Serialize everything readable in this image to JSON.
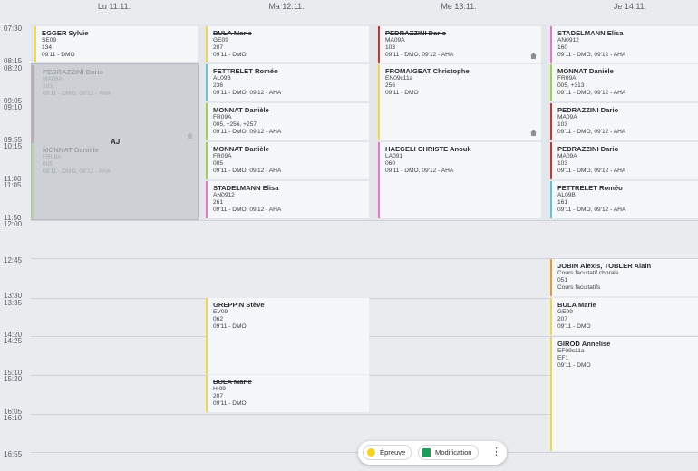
{
  "days": [
    {
      "label": "Lu 11.11."
    },
    {
      "label": "Ma 12.11."
    },
    {
      "label": "Me 13.11."
    },
    {
      "label": "Je 14.11."
    }
  ],
  "time_labels": [
    "07:30",
    "08:15",
    "08:20",
    "09:05",
    "09:10",
    "09:55",
    "10:15",
    "11:00",
    "11:05",
    "11:50",
    "12:00",
    "12:45",
    "13:30",
    "13:35",
    "14:20",
    "14:25",
    "15:10",
    "15:20",
    "16:05",
    "16:10",
    "16:55"
  ],
  "absence": {
    "code": "AJ",
    "lessons": [
      {
        "teacher": "PEDRAZZINI Dario",
        "lines": [
          "MA09A",
          "103",
          "09'11 - DMO, 09'12 - AHA"
        ]
      },
      {
        "teacher": "MONNAT Danièle",
        "lines": [
          "FR09A",
          "005",
          "09'11 - DMO, 09'12 - AHA"
        ]
      }
    ]
  },
  "lessons": [
    {
      "teacher": "EGGER Sylvie",
      "lines": [
        "SE09",
        "134",
        "09'11 - DMO"
      ],
      "color": "#f0d64a"
    },
    {
      "teacher": "BULA Marie",
      "lines": [
        "GE09",
        "207",
        "09'11 - DMO"
      ],
      "color": "#f0d64a",
      "cancelled": true
    },
    {
      "teacher": "FETTRELET Roméo",
      "lines": [
        "AL09B",
        "236",
        "09'11 - DMO, 09'12 - AHA"
      ],
      "color": "#59c9d8"
    },
    {
      "teacher": "MONNAT Danièle",
      "lines": [
        "FR09A",
        "005, +256, +257",
        "09'11 - DMO, 09'12 - AHA"
      ],
      "color": "#9ed24a"
    },
    {
      "teacher": "MONNAT Danièle",
      "lines": [
        "FR09A",
        "005",
        "09'11 - DMO, 09'12 - AHA"
      ],
      "color": "#9ed24a"
    },
    {
      "teacher": "STADELMANN Elisa",
      "lines": [
        "AN0912",
        "261",
        "09'11 - DMO, 09'12 - AHA"
      ],
      "color": "#e874c9"
    },
    {
      "teacher": "GREPPIN Stève",
      "lines": [
        "EV09",
        "062",
        "09'11 - DMO"
      ],
      "color": "#f0d64a"
    },
    {
      "teacher": "BULA Marie",
      "lines": [
        "HI09",
        "207",
        "09'11 - DMO"
      ],
      "color": "#f0d64a",
      "cancelled": true
    },
    {
      "teacher": "PEDRAZZINI Dario",
      "lines": [
        "MA09A",
        "103",
        "09'11 - DMO, 09'12 - AHA"
      ],
      "color": "#d2302f",
      "cancelled": true,
      "house": true
    },
    {
      "teacher": "FROMAIGEAT Christophe",
      "lines": [
        "EN09c11a",
        "256",
        "09'11 - DMO"
      ],
      "color": "#f0d64a",
      "house": true
    },
    {
      "teacher": "HAEGELI CHRISTE Anouk",
      "lines": [
        "LA091",
        "060",
        "09'11 - DMO, 09'12 - AHA"
      ],
      "color": "#e874c9"
    },
    {
      "teacher": "STADELMANN Elisa",
      "lines": [
        "AN0912",
        "160",
        "09'11 - DMO, 09'12 - AHA"
      ],
      "color": "#e874c9"
    },
    {
      "teacher": "MONNAT Danièle",
      "lines": [
        "FR09A",
        "005, +313",
        "09'11 - DMO, 09'12 - AHA"
      ],
      "color": "#9ed24a"
    },
    {
      "teacher": "PEDRAZZINI Dario",
      "lines": [
        "MA09A",
        "103",
        "09'11 - DMO, 09'12 - AHA"
      ],
      "color": "#d2302f"
    },
    {
      "teacher": "PEDRAZZINI Dario",
      "lines": [
        "MA09A",
        "103",
        "09'11 - DMO, 09'12 - AHA"
      ],
      "color": "#d2302f"
    },
    {
      "teacher": "FETTRELET Roméo",
      "lines": [
        "AL09B",
        "161",
        "09'11 - DMO, 09'12 - AHA"
      ],
      "color": "#59c9d8"
    },
    {
      "teacher": "JOBIN Alexis, TOBLER Alain",
      "lines": [
        "Cours facultatif chorale",
        "051",
        "Cours facultatifs"
      ],
      "color": "#e89a2a"
    },
    {
      "teacher": "BULA Marie",
      "lines": [
        "GE09",
        "207",
        "09'11 - DMO"
      ],
      "color": "#f0d64a"
    },
    {
      "teacher": "GIROD Annelise",
      "lines": [
        "EF09c11a",
        "EF1",
        "09'11 - DMO"
      ],
      "color": "#f0d64a"
    }
  ],
  "legend": {
    "epreuve_label": "Épreuve",
    "epreuve_color": "#f5d21e",
    "modification_label": "Modification",
    "modification_color": "#1e9e5b",
    "more_label": "⋮"
  }
}
